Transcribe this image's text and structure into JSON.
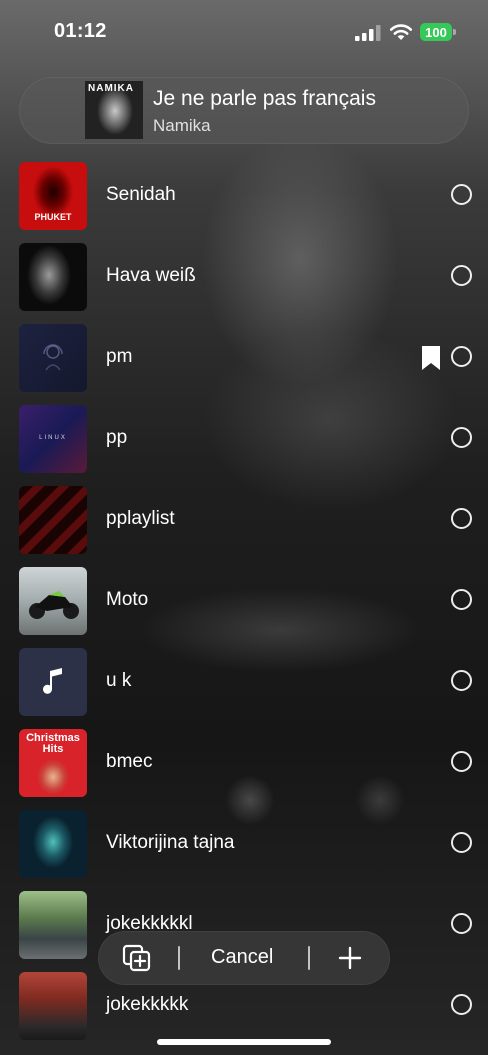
{
  "status_bar": {
    "time": "01:12",
    "battery": "100",
    "icons": [
      "cellular-signal-icon",
      "wifi-icon",
      "battery-icon"
    ]
  },
  "now_playing": {
    "artwork_text": "NAMIKA",
    "title": "Je ne parle pas français",
    "artist": "Namika"
  },
  "playlists": [
    {
      "name": "Senidah",
      "artwork_text": "PHUKET",
      "bookmarked": false,
      "selected": false
    },
    {
      "name": "Hava weiß",
      "artwork_text": "",
      "bookmarked": false,
      "selected": false
    },
    {
      "name": "pm",
      "artwork_text": "",
      "bookmarked": true,
      "selected": false
    },
    {
      "name": "pp",
      "artwork_text": "LINUX",
      "bookmarked": false,
      "selected": false
    },
    {
      "name": "pplaylist",
      "artwork_text": "",
      "bookmarked": false,
      "selected": false
    },
    {
      "name": "Moto",
      "artwork_text": "",
      "bookmarked": false,
      "selected": false
    },
    {
      "name": "u k",
      "artwork_text": "",
      "bookmarked": false,
      "selected": false
    },
    {
      "name": "bmec",
      "artwork_text": "Christmas Hits",
      "bookmarked": false,
      "selected": false
    },
    {
      "name": "Viktorijina tajna",
      "artwork_text": "",
      "bookmarked": false,
      "selected": false
    },
    {
      "name": "jokekkkkkl",
      "artwork_text": "",
      "bookmarked": false,
      "selected": false
    },
    {
      "name": "jokekkkkk",
      "artwork_text": "",
      "bookmarked": false,
      "selected": false
    }
  ],
  "toolbar": {
    "cancel_label": "Cancel",
    "icons": [
      "add-to-playlist-icon",
      "plus-icon"
    ]
  },
  "colors": {
    "battery": "#36c859",
    "text": "#ffffff"
  }
}
